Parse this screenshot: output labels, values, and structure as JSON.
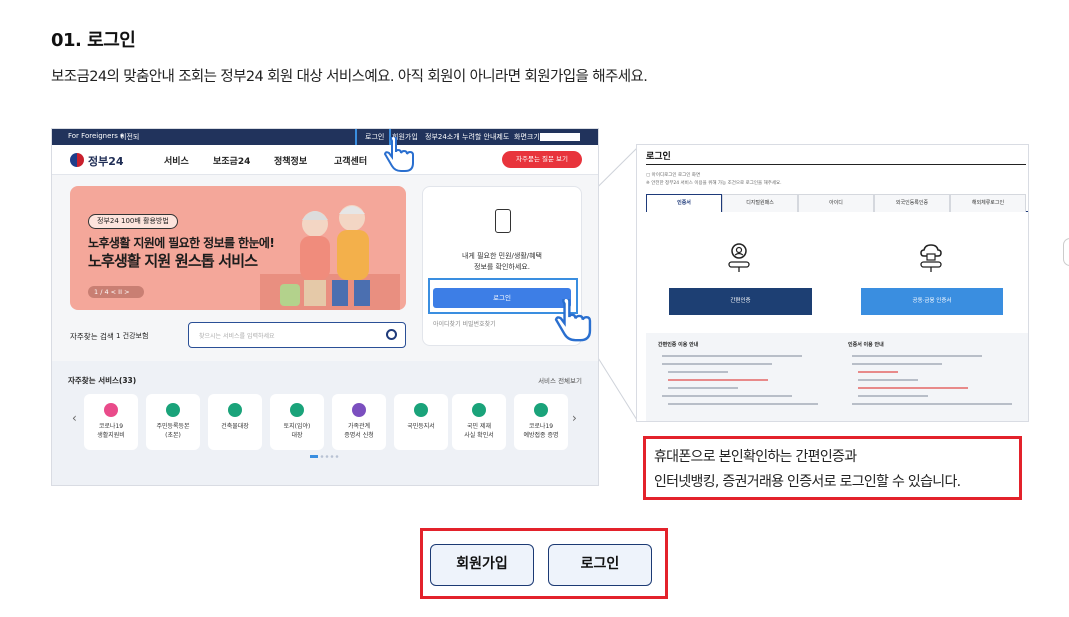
{
  "section": {
    "heading": "01. 로그인",
    "description": "보조금24의 맞춤안내 조회는 정부24 회원 대상 서비스예요. 아직 회원이 아니라면 회원가입을 해주세요."
  },
  "left_screenshot": {
    "topbar": {
      "lang": "For Foreigners ▾",
      "previous": "이전되",
      "login": "로그인",
      "signup": "회원가입",
      "intro": "정부24소개",
      "accessibility": "누려할 안내제도",
      "zoom": "화면크기",
      "zoom_value": "100%"
    },
    "nav": {
      "logo": "정부24",
      "items": [
        "서비스",
        "보조금24",
        "정책정보",
        "고객센터"
      ],
      "cta": "자주묻는 질문 보기"
    },
    "banner": {
      "tag": "정부24 100배 활용방법",
      "line1": "노후생활 지원에 필요한 정보를 한눈에!",
      "line2": "노후생활 지원 원스톱 서비스",
      "pager": "1 / 4  <  II  >"
    },
    "login_card": {
      "line1": "내게 필요한 민원/생활/혜택",
      "line2": "정보를 확인하세요.",
      "button": "로그인",
      "links": "아이디찾기    비밀번호찾기"
    },
    "search": {
      "label": "자주찾는 검색",
      "select": "1 건강보험",
      "placeholder": "찾으시는 서비스를 입력하세요"
    },
    "favorites": {
      "title": "자주찾는 서비스(33)",
      "more": "서비스 전체보기",
      "items": [
        {
          "label": "코로나19\n생활지원비",
          "color": "#e94b8a"
        },
        {
          "label": "주민등록등본\n(초본)",
          "color": "#1aa37a"
        },
        {
          "label": "건축물대장",
          "color": "#1aa37a"
        },
        {
          "label": "토지(임야)\n대장",
          "color": "#1aa37a"
        },
        {
          "label": "가족관계\n증명서 신청",
          "color": "#7b4fbf"
        },
        {
          "label": "국민등지서",
          "color": "#1aa37a"
        },
        {
          "label": "국민 제재\n사실 확인서",
          "color": "#1aa37a"
        },
        {
          "label": "코로나19\n예방접종 증명",
          "color": "#1aa37a"
        }
      ]
    }
  },
  "right_screenshot": {
    "title": "로그인",
    "notes": [
      "▢ 아이디로그인 로그인 화면",
      "※ 안전한 정부24 서비스 이용을 위해 가능 조건으로 로그인을 해주세요."
    ],
    "tabs": [
      "인증서",
      "디지털원패스",
      "아이디",
      "외국인등록인증",
      "해외체류로그인"
    ],
    "buttons": {
      "simple_auth": "간편인증",
      "certificate": "공동·금융 인증서"
    },
    "info_heads": [
      "간편인증 이용 안내",
      "인증서 이용 안내"
    ]
  },
  "caption": {
    "line1": "휴대폰으로 본인확인하는 간편인증과",
    "line2": "인터넷뱅킹, 증권거래용 인증서로 로그인할 수 있습니다."
  },
  "actions": {
    "signup": "회원가입",
    "login": "로그인"
  },
  "colors": {
    "highlight_red": "#e3222b",
    "navy": "#1c3a74",
    "button_fill": "#eef3fb"
  }
}
